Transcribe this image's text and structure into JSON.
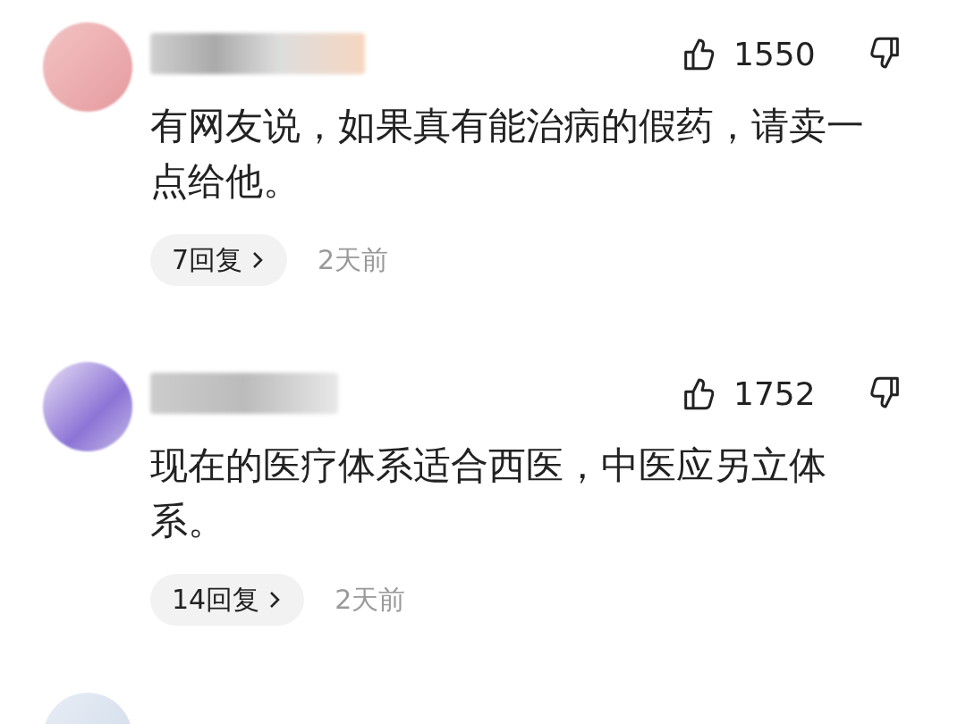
{
  "comments": [
    {
      "likes": "1550",
      "text": "有网友说，如果真有能治病的假药，请卖一点给他。",
      "replies": "7回复",
      "time": "2天前"
    },
    {
      "likes": "1752",
      "text": "现在的医疗体系适合西医，中医应另立体系。",
      "replies": "14回复",
      "time": "2天前"
    }
  ]
}
